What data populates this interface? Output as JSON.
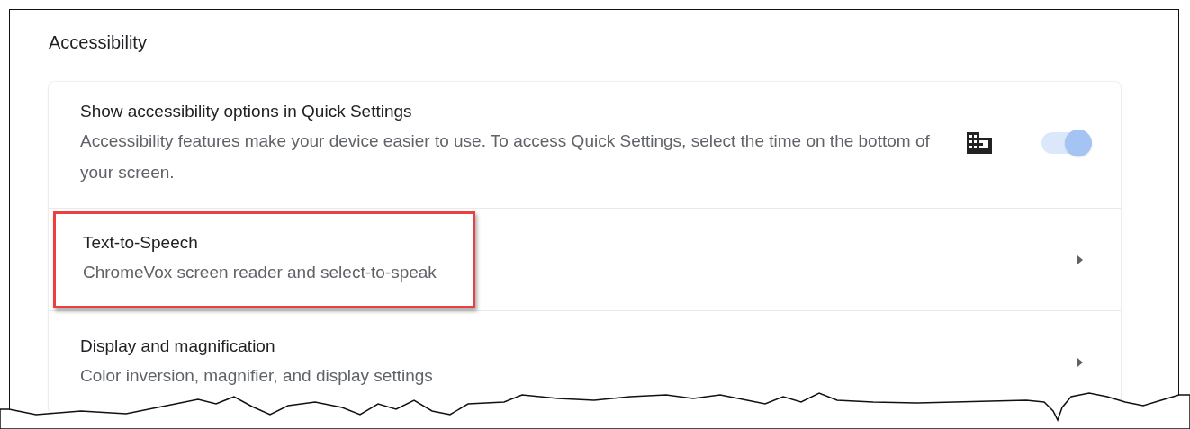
{
  "section": {
    "title": "Accessibility"
  },
  "rows": [
    {
      "kind": "toggle",
      "title": "Show accessibility options in Quick Settings",
      "description": "Accessibility features make your device easier to use. To access Quick Settings, select the time on the bottom of your screen.",
      "managed": true,
      "on": true,
      "highlighted": false
    },
    {
      "kind": "link",
      "title": "Text-to-Speech",
      "description": "ChromeVox screen reader and select-to-speak",
      "highlighted": true
    },
    {
      "kind": "link",
      "title": "Display and magnification",
      "description": "Color inversion, magnifier, and display settings",
      "highlighted": false
    }
  ]
}
